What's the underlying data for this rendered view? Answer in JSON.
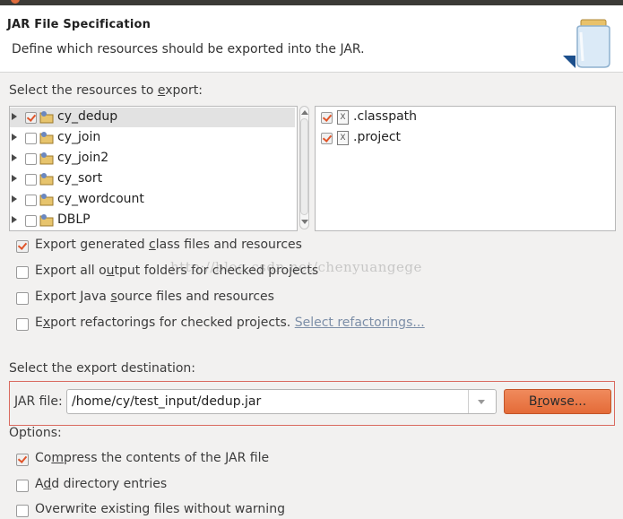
{
  "header": {
    "title": "JAR File Specification",
    "description": "Define which resources should be exported into the JAR."
  },
  "resources": {
    "label_pre": "Select the resources to ",
    "label_mnemonic": "e",
    "label_post": "xport:",
    "projects": [
      {
        "name": "cy_dedup",
        "checked": true,
        "selected": true
      },
      {
        "name": "cy_join",
        "checked": false
      },
      {
        "name": "cy_join2",
        "checked": false
      },
      {
        "name": "cy_sort",
        "checked": false
      },
      {
        "name": "cy_wordcount",
        "checked": false
      },
      {
        "name": "DBLP",
        "checked": false
      }
    ],
    "files": [
      {
        "name": ".classpath",
        "checked": true,
        "icon": "X"
      },
      {
        "name": ".project",
        "checked": true,
        "icon": "X"
      }
    ]
  },
  "options_export": {
    "class_files": {
      "pre": "Export generated ",
      "mn": "c",
      "post": "lass files and resources",
      "checked": true
    },
    "output_folders": {
      "pre": "Export all o",
      "mn": "u",
      "post": "tput folders for checked projects",
      "checked": false
    },
    "source_files": {
      "pre": "Export Java ",
      "mn": "s",
      "post": "ource files and resources",
      "checked": false
    },
    "refactorings": {
      "pre": "E",
      "mn": "x",
      "post": "port refactorings for checked projects.",
      "checked": false,
      "link": "Select refactorings..."
    }
  },
  "watermark": "http://blog.csdn.net/chenyuangege",
  "destination": {
    "label": "Select the export destination:",
    "jar_label_mn": "J",
    "jar_label_post": "AR file:",
    "jar_path": "/home/cy/test_input/dedup.jar",
    "browse_pre": "B",
    "browse_mn": "r",
    "browse_post": "owse..."
  },
  "options": {
    "label": "Options:",
    "compress": {
      "pre": "Co",
      "mn": "m",
      "post": "press the contents of the JAR file",
      "checked": true
    },
    "directory": {
      "pre": "A",
      "mn": "d",
      "post": "d directory entries",
      "checked": false
    },
    "overwrite": {
      "pre": "Overwrite existing files without warning",
      "checked": false
    }
  },
  "colors": {
    "accent": "#e46b38",
    "check": "#e0552a",
    "highlight_box": "#d96a5f"
  }
}
